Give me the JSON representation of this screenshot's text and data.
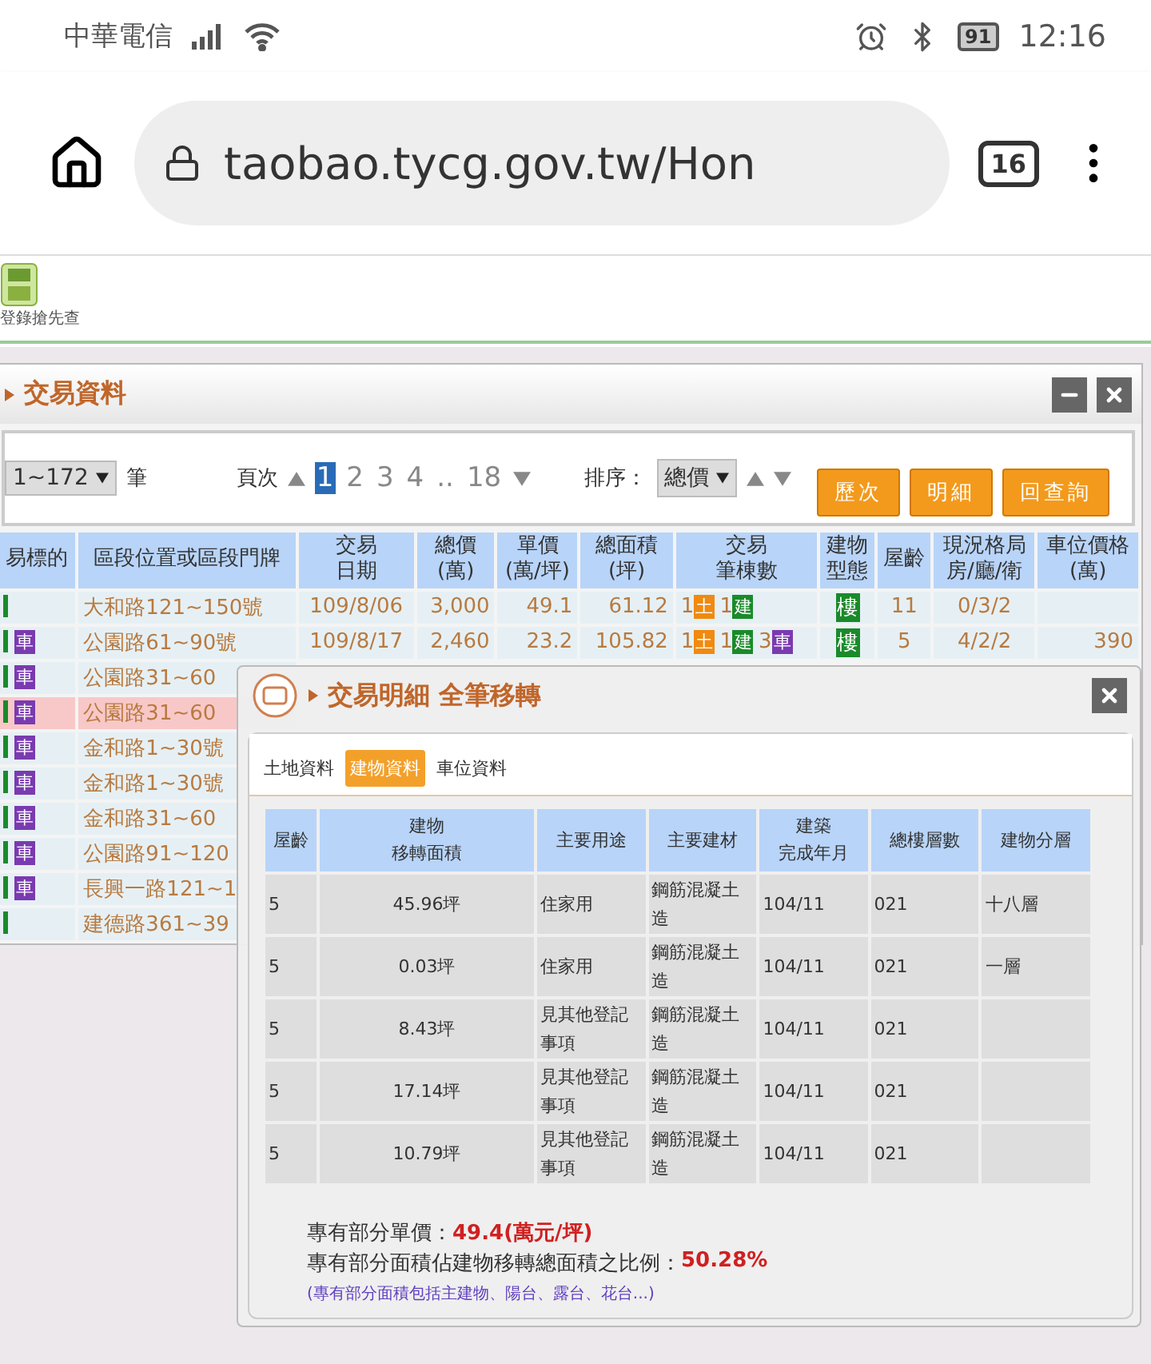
{
  "status_bar": {
    "carrier": "中華電信",
    "battery": "91",
    "time": "12:16"
  },
  "browser": {
    "url": "taobao.tycg.gov.tw/Hon",
    "tab_count": "16"
  },
  "toolbar": {
    "label": "登錄搶先查"
  },
  "panel": {
    "title": "交易資料",
    "range": "1~172",
    "range_unit": "筆",
    "page_label": "頁次",
    "pages": [
      {
        "label": "1",
        "selected": true
      },
      {
        "label": "2",
        "selected": false
      },
      {
        "label": "3",
        "selected": false
      },
      {
        "label": "4",
        "selected": false
      },
      {
        "label": "..",
        "selected": false
      },
      {
        "label": "18",
        "selected": false
      }
    ],
    "sort_label": "排序：",
    "sort_value": "總價",
    "buttons": [
      "歷次",
      "明細",
      "回查詢"
    ],
    "columns": [
      {
        "title": "易標的"
      },
      {
        "title": "區段位置或區段門牌"
      },
      {
        "title": "交易",
        "subtitle": "日期"
      },
      {
        "title": "總價",
        "subtitle": "(萬)"
      },
      {
        "title": "單價",
        "subtitle": "(萬/坪)"
      },
      {
        "title": "總面積",
        "subtitle": "(坪)"
      },
      {
        "title": "交易",
        "subtitle": "筆棟數"
      },
      {
        "title": "建物",
        "subtitle": "型態"
      },
      {
        "title": "屋齡"
      },
      {
        "title": "現況格局",
        "subtitle": "房/廳/衛"
      },
      {
        "title": "車位價格",
        "subtitle": "(萬)"
      }
    ],
    "rows": [
      {
        "tag": "",
        "address": "大和路121~150號",
        "date": "109/8/06",
        "total": "3,000",
        "unit": "49.1",
        "area": "61.12",
        "counts": [
          {
            "count": "1",
            "kind": "land",
            "label": "土"
          },
          {
            "count": "1",
            "kind": "building",
            "label": "建"
          }
        ],
        "type": "樓",
        "age": "11",
        "layout": "0/3/2",
        "parking": "",
        "selected": false
      },
      {
        "tag": "車",
        "address": "公園路61~90號",
        "date": "109/8/17",
        "total": "2,460",
        "unit": "23.2",
        "area": "105.82",
        "counts": [
          {
            "count": "1",
            "kind": "land",
            "label": "土"
          },
          {
            "count": "1",
            "kind": "building",
            "label": "建"
          },
          {
            "count": "3",
            "kind": "parking",
            "label": "車"
          }
        ],
        "type": "樓",
        "age": "5",
        "layout": "4/2/2",
        "parking": "390",
        "selected": false
      },
      {
        "tag": "車",
        "address": "公園路31~60",
        "selected": false
      },
      {
        "tag": "車",
        "address": "公園路31~60",
        "selected": true
      },
      {
        "tag": "車",
        "address": "金和路1~30號",
        "selected": false
      },
      {
        "tag": "車",
        "address": "金和路1~30號",
        "selected": false
      },
      {
        "tag": "車",
        "address": "金和路31~60",
        "selected": false
      },
      {
        "tag": "車",
        "address": "公園路91~120",
        "selected": false
      },
      {
        "tag": "車",
        "address": "長興一路121~1",
        "selected": false
      },
      {
        "tag": "",
        "address": "建德路361~39",
        "selected": false
      }
    ]
  },
  "detail": {
    "title": "交易明細 全筆移轉",
    "tabs": [
      {
        "label": "土地資料",
        "selected": false
      },
      {
        "label": "建物資料",
        "selected": true
      },
      {
        "label": "車位資料",
        "selected": false
      }
    ],
    "columns": [
      {
        "title": "屋齡"
      },
      {
        "title": "建物",
        "subtitle": "移轉面積"
      },
      {
        "title": "主要用途"
      },
      {
        "title": "主要建材"
      },
      {
        "title": "建築",
        "subtitle": "完成年月"
      },
      {
        "title": "總樓層數"
      },
      {
        "title": "建物分層"
      }
    ],
    "rows": [
      [
        "5",
        "45.96坪",
        "住家用",
        "鋼筋混凝土造",
        "104/11",
        "021",
        "十八層"
      ],
      [
        "5",
        "0.03坪",
        "住家用",
        "鋼筋混凝土造",
        "104/11",
        "021",
        "一層"
      ],
      [
        "5",
        "8.43坪",
        "見其他登記事項",
        "鋼筋混凝土造",
        "104/11",
        "021",
        ""
      ],
      [
        "5",
        "17.14坪",
        "見其他登記事項",
        "鋼筋混凝土造",
        "104/11",
        "021",
        ""
      ],
      [
        "5",
        "10.79坪",
        "見其他登記事項",
        "鋼筋混凝土造",
        "104/11",
        "021",
        ""
      ]
    ],
    "summary": [
      {
        "label": "專有部分單價：",
        "value": "49.4(萬元/坪)"
      },
      {
        "label": "專有部分面積佔建物移轉總面積之比例：",
        "value": "50.28%"
      }
    ],
    "note": "(專有部分面積包括主建物、陽台、露台、花台...)"
  }
}
